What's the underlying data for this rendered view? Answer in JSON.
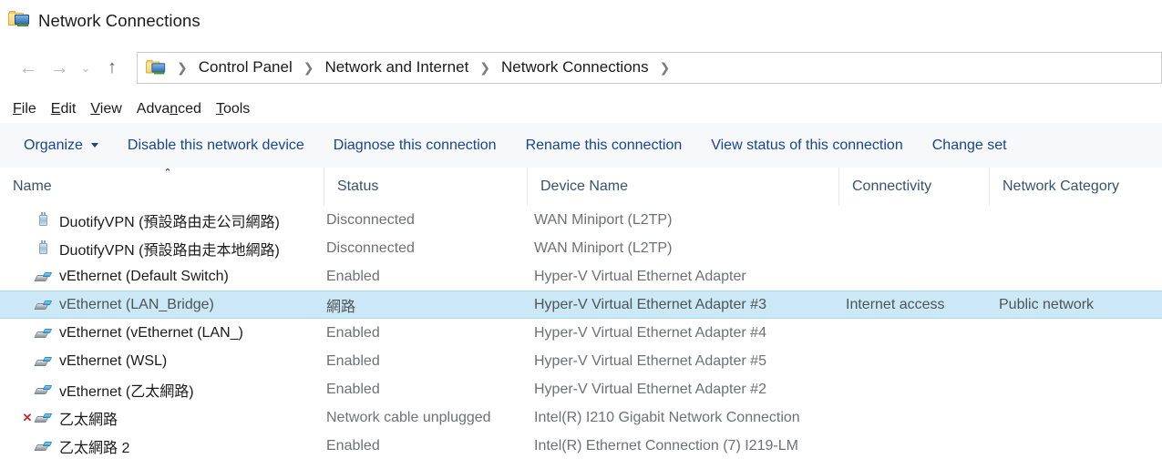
{
  "window": {
    "title": "Network Connections",
    "title_icon": "network-connections-folder-icon"
  },
  "nav": {
    "back_icon": "←",
    "forward_icon": "→",
    "recent_icon": "⌄",
    "up_icon": "↑",
    "back_name": "back-button",
    "forward_name": "forward-button",
    "recent_name": "recent-locations-button",
    "up_name": "up-button"
  },
  "breadcrumb": {
    "separator": "❯",
    "items": [
      "Control Panel",
      "Network and Internet",
      "Network Connections"
    ]
  },
  "menu": {
    "items": [
      {
        "pre": "",
        "key": "F",
        "post": "ile"
      },
      {
        "pre": "",
        "key": "E",
        "post": "dit"
      },
      {
        "pre": "",
        "key": "V",
        "post": "iew"
      },
      {
        "pre": "Adva",
        "key": "n",
        "post": "ced"
      },
      {
        "pre": "",
        "key": "T",
        "post": "ools"
      }
    ]
  },
  "toolbar": {
    "organize_label": "Organize",
    "items": [
      "Disable this network device",
      "Diagnose this connection",
      "Rename this connection",
      "View status of this connection",
      "Change set"
    ]
  },
  "columns": {
    "name": "Name",
    "status": "Status",
    "device": "Device Name",
    "connectivity": "Connectivity",
    "category": "Network Category",
    "sort_indicator": "⌃"
  },
  "colors": {
    "selection_bg": "#cce8f7",
    "selection_border": "#a8d6ef",
    "toolbar_link": "#17458f",
    "column_header_text": "#38536e",
    "secondary_text": "#6e7073",
    "error_red": "#c42b2b"
  },
  "rows": [
    {
      "icon": "vpn-connection-icon",
      "name": "DuotifyVPN (預設路由走公司網路)",
      "status": "Disconnected",
      "device": "WAN Miniport (L2TP)",
      "connectivity": "",
      "category": "",
      "selected": false,
      "error": false
    },
    {
      "icon": "vpn-connection-icon",
      "name": "DuotifyVPN (預設路由走本地網路)",
      "status": "Disconnected",
      "device": "WAN Miniport (L2TP)",
      "connectivity": "",
      "category": "",
      "selected": false,
      "error": false
    },
    {
      "icon": "network-adapter-icon",
      "name": "vEthernet (Default Switch)",
      "status": "Enabled",
      "device": "Hyper-V Virtual Ethernet Adapter",
      "connectivity": "",
      "category": "",
      "selected": false,
      "error": false
    },
    {
      "icon": "network-adapter-icon",
      "name": "vEthernet (LAN_Bridge)",
      "status": "網路",
      "device": "Hyper-V Virtual Ethernet Adapter #3",
      "connectivity": "Internet access",
      "category": "Public network",
      "selected": true,
      "error": false
    },
    {
      "icon": "network-adapter-icon",
      "name": "vEthernet (vEthernet (LAN_)",
      "status": "Enabled",
      "device": "Hyper-V Virtual Ethernet Adapter #4",
      "connectivity": "",
      "category": "",
      "selected": false,
      "error": false
    },
    {
      "icon": "network-adapter-icon",
      "name": "vEthernet (WSL)",
      "status": "Enabled",
      "device": "Hyper-V Virtual Ethernet Adapter #5",
      "connectivity": "",
      "category": "",
      "selected": false,
      "error": false
    },
    {
      "icon": "network-adapter-icon",
      "name": "vEthernet (乙太網路)",
      "status": "Enabled",
      "device": "Hyper-V Virtual Ethernet Adapter #2",
      "connectivity": "",
      "category": "",
      "selected": false,
      "error": false
    },
    {
      "icon": "network-adapter-icon",
      "name": "乙太網路",
      "status": "Network cable unplugged",
      "device": "Intel(R) I210 Gigabit Network Connection",
      "connectivity": "",
      "category": "",
      "selected": false,
      "error": true,
      "error_icon": "✕"
    },
    {
      "icon": "network-adapter-icon",
      "name": "乙太網路 2",
      "status": "Enabled",
      "device": "Intel(R) Ethernet Connection (7) I219-LM",
      "connectivity": "",
      "category": "",
      "selected": false,
      "error": false
    }
  ]
}
